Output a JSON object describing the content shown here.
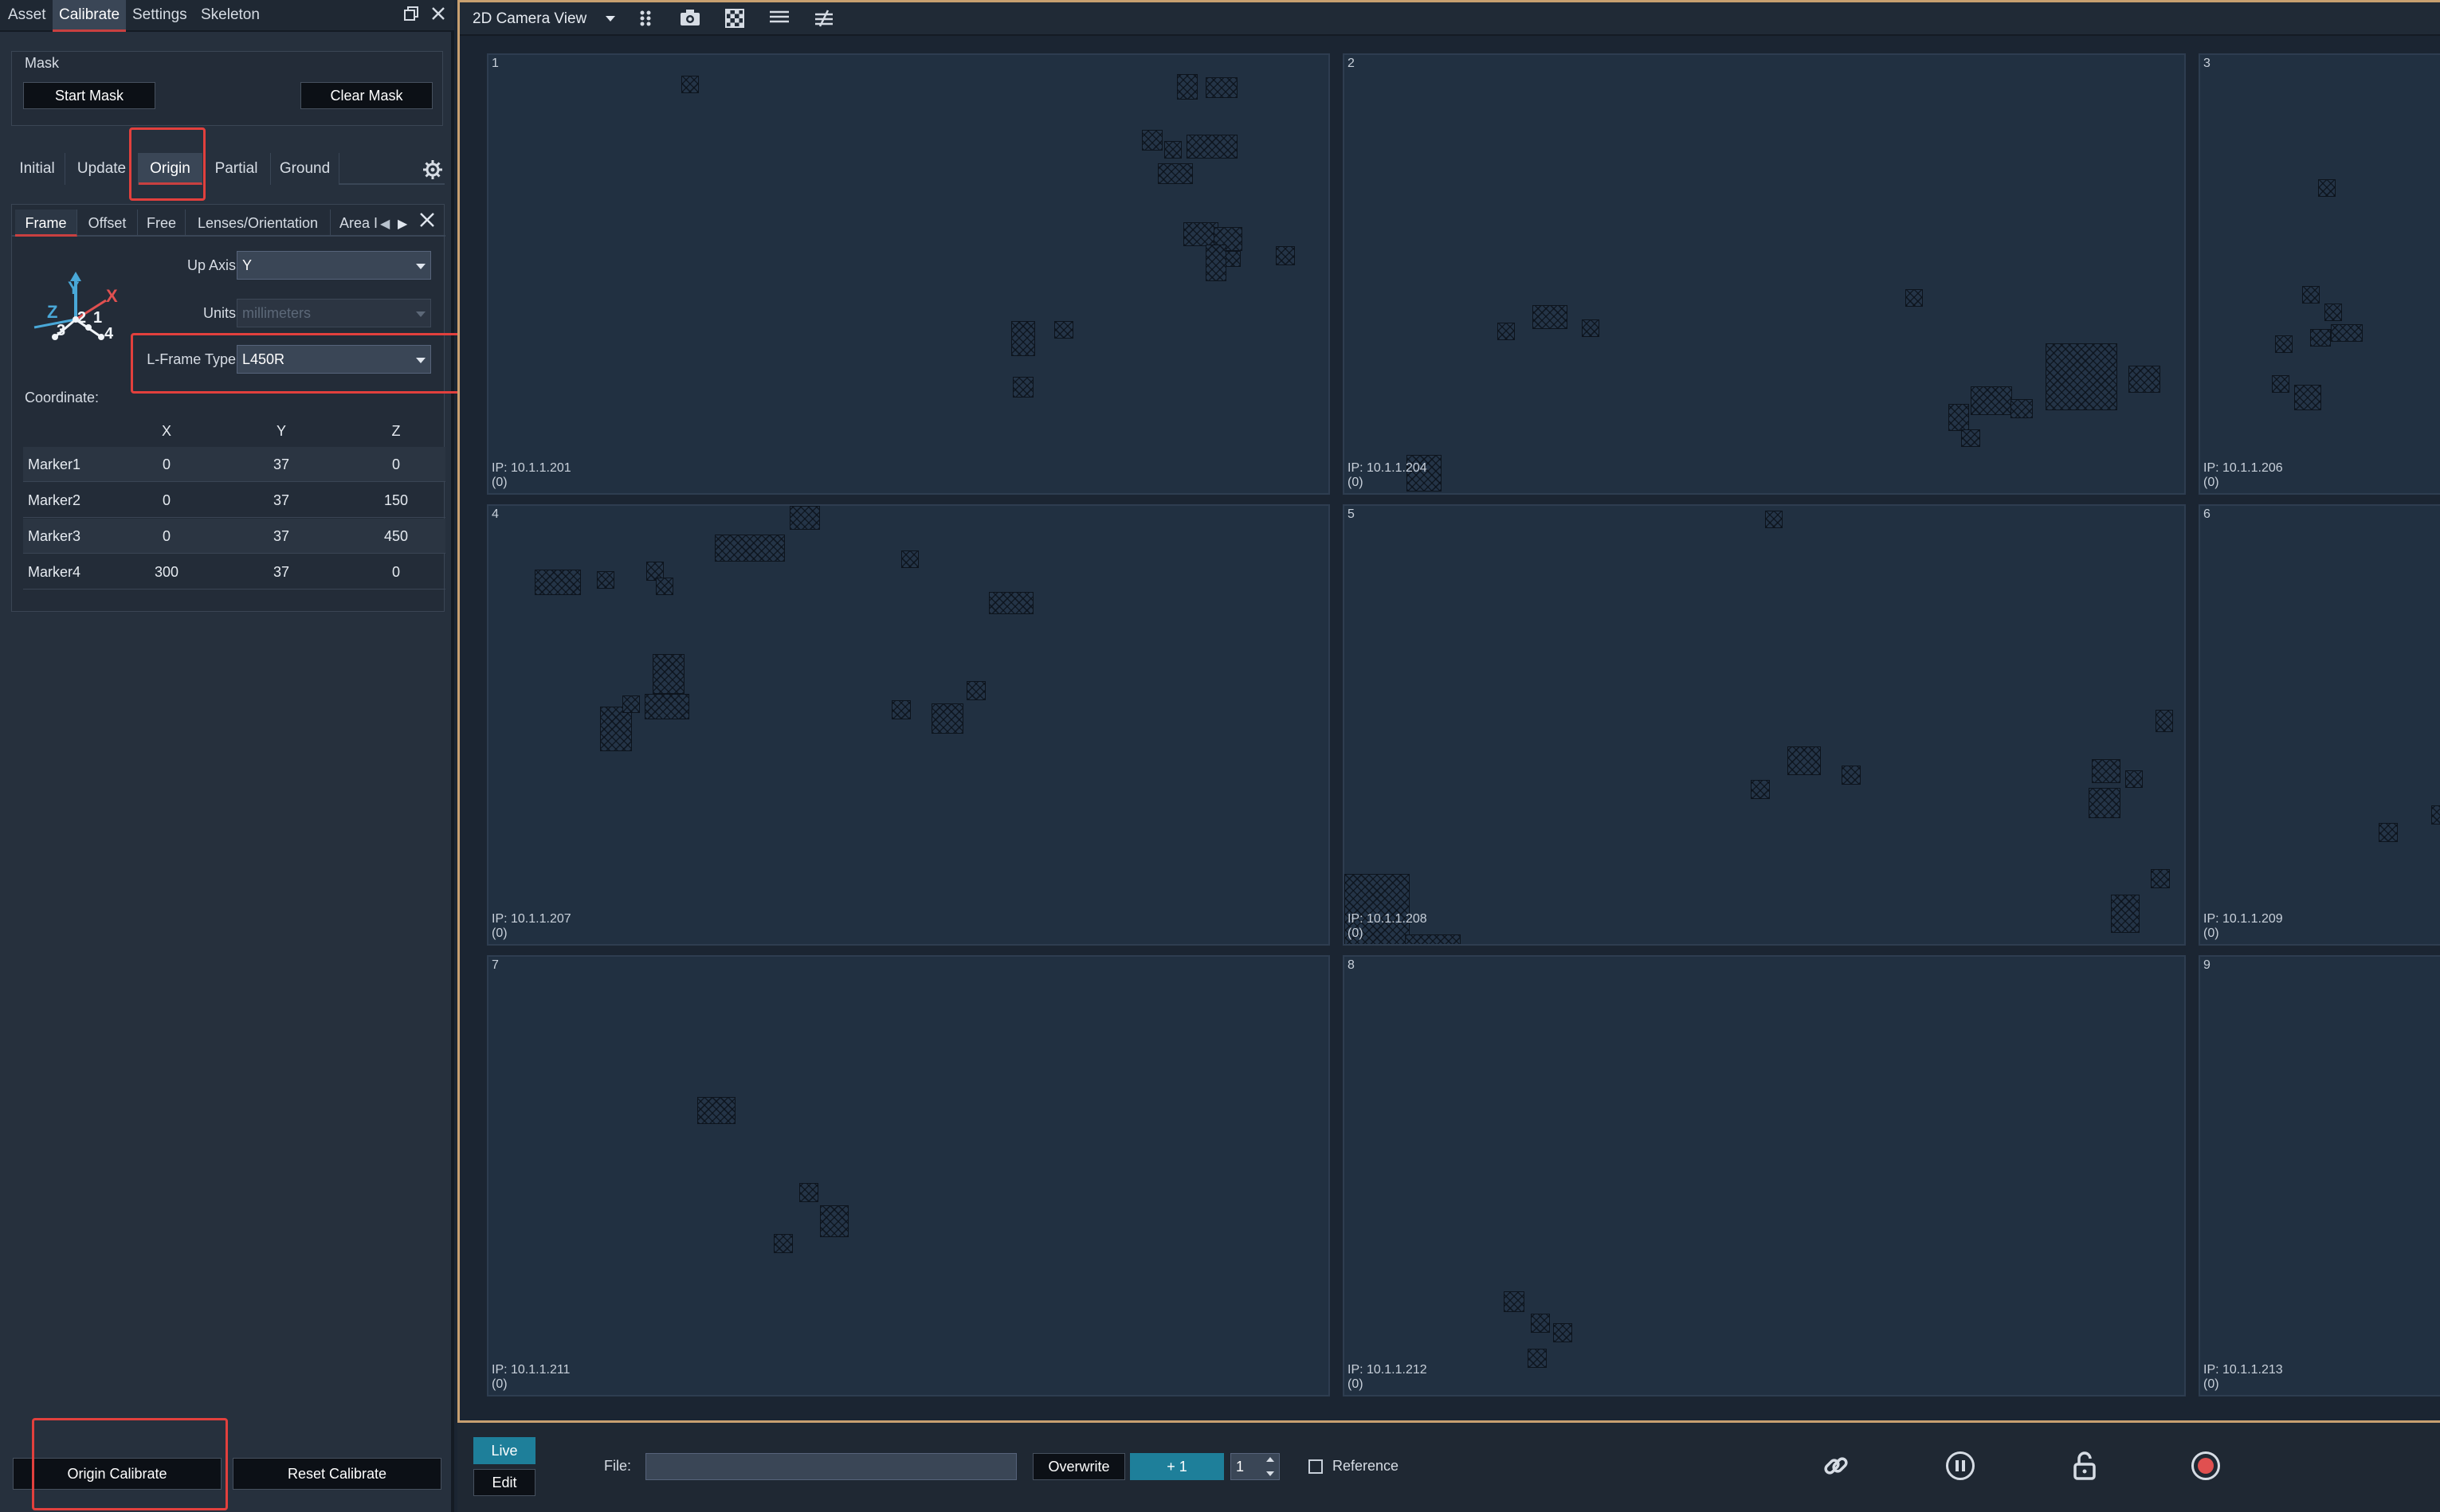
{
  "top_tabs": [
    {
      "label": "Asset"
    },
    {
      "label": "Calibrate"
    },
    {
      "label": "Settings"
    },
    {
      "label": "Skeleton"
    }
  ],
  "mask": {
    "title": "Mask",
    "start_label": "Start Mask",
    "clear_label": "Clear Mask"
  },
  "calib_tabs": [
    {
      "label": "Initial"
    },
    {
      "label": "Update"
    },
    {
      "label": "Origin"
    },
    {
      "label": "Partial"
    },
    {
      "label": "Ground"
    }
  ],
  "sub_tabs": [
    {
      "label": "Frame"
    },
    {
      "label": "Offset"
    },
    {
      "label": "Free"
    },
    {
      "label": "Lenses/Orientation"
    },
    {
      "label": "Area I"
    }
  ],
  "axis_icon": {
    "y": "Y",
    "z": "Z",
    "x": "X",
    "n1": "1",
    "n2": "2",
    "n3": "3",
    "n4": "4"
  },
  "fields": {
    "up_axis_label": "Up Axis:",
    "up_axis_value": "Y",
    "units_label": "Units:",
    "units_value": "millimeters",
    "lframe_label": "L-Frame Type:",
    "lframe_value": "L450R",
    "coordinate_label": "Coordinate:"
  },
  "coord_table": {
    "headers": [
      "X",
      "Y",
      "Z"
    ],
    "rows": [
      {
        "name": "Marker1",
        "x": "0",
        "y": "37",
        "z": "0"
      },
      {
        "name": "Marker2",
        "x": "0",
        "y": "37",
        "z": "150"
      },
      {
        "name": "Marker3",
        "x": "0",
        "y": "37",
        "z": "450"
      },
      {
        "name": "Marker4",
        "x": "300",
        "y": "37",
        "z": "0"
      }
    ]
  },
  "bottom_buttons": {
    "origin_calibrate": "Origin Calibrate",
    "reset_calibrate": "Reset Calibrate"
  },
  "view": {
    "title": "2D Camera View",
    "toolbar_icons": [
      "markers-icon",
      "camera-icon",
      "checkerboard-icon",
      "lines-icon",
      "not-equal-icon"
    ]
  },
  "cameras": [
    {
      "num": "1",
      "ip": "IP: 10.1.1.201",
      "count": "(0)"
    },
    {
      "num": "2",
      "ip": "IP: 10.1.1.204",
      "count": "(0)"
    },
    {
      "num": "3",
      "ip": "IP: 10.1.1.206",
      "count": "(0)"
    },
    {
      "num": "4",
      "ip": "IP: 10.1.1.207",
      "count": "(0)"
    },
    {
      "num": "5",
      "ip": "IP: 10.1.1.208",
      "count": "(0)"
    },
    {
      "num": "6",
      "ip": "IP: 10.1.1.209",
      "count": "(0)"
    },
    {
      "num": "7",
      "ip": "IP: 10.1.1.211",
      "count": "(0)"
    },
    {
      "num": "8",
      "ip": "IP: 10.1.1.212",
      "count": "(0)"
    },
    {
      "num": "9",
      "ip": "IP: 10.1.1.213",
      "count": "(0)"
    }
  ],
  "bottom_bar": {
    "live": "Live",
    "edit": "Edit",
    "file_label": "File:",
    "file_value": "",
    "overwrite": "Overwrite",
    "increment": "+ 1",
    "take_number": "1",
    "reference_label": "Reference"
  },
  "colors": {
    "accent_tab": "#c94040",
    "highlight_box": "#e2403d",
    "live_button": "#1e7f9a",
    "record": "#e05050",
    "frame_border": "#c8a070"
  }
}
